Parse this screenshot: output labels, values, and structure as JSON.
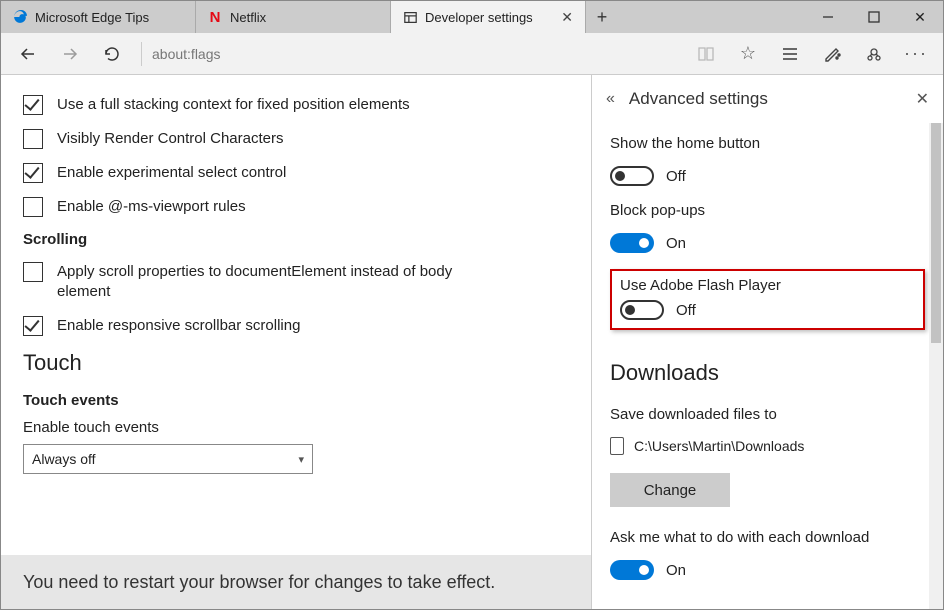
{
  "tabs": [
    {
      "label": "Microsoft Edge Tips",
      "favicon": "edge"
    },
    {
      "label": "Netflix",
      "favicon": "netflix"
    },
    {
      "label": "Developer settings",
      "favicon": "panel",
      "active": true
    }
  ],
  "address": "about:flags",
  "flags": {
    "items": [
      {
        "label": "Use a full stacking context for fixed position elements",
        "checked": true
      },
      {
        "label": "Visibly Render Control Characters",
        "checked": false
      },
      {
        "label": "Enable experimental select control",
        "checked": true
      },
      {
        "label": "Enable @-ms-viewport rules",
        "checked": false
      }
    ],
    "scroll_heading": "Scrolling",
    "scroll_items": [
      {
        "label": "Apply scroll properties to documentElement instead of body element",
        "checked": false
      },
      {
        "label": "Enable responsive scrollbar scrolling",
        "checked": true
      }
    ],
    "touch_heading": "Touch",
    "touch_events_heading": "Touch events",
    "touch_select_label": "Enable touch events",
    "touch_select_value": "Always off",
    "restart_msg": "You need to restart your browser for changes to take effect."
  },
  "panel": {
    "title": "Advanced settings",
    "home_btn_label": "Show the home button",
    "home_btn_state": "Off",
    "popups_label": "Block pop-ups",
    "popups_state": "On",
    "flash_label": "Use Adobe Flash Player",
    "flash_state": "Off",
    "downloads_heading": "Downloads",
    "save_to_label": "Save downloaded files to",
    "save_path": "C:\\Users\\Martin\\Downloads",
    "change_label": "Change",
    "askme_label": "Ask me what to do with each download",
    "askme_state": "On"
  }
}
